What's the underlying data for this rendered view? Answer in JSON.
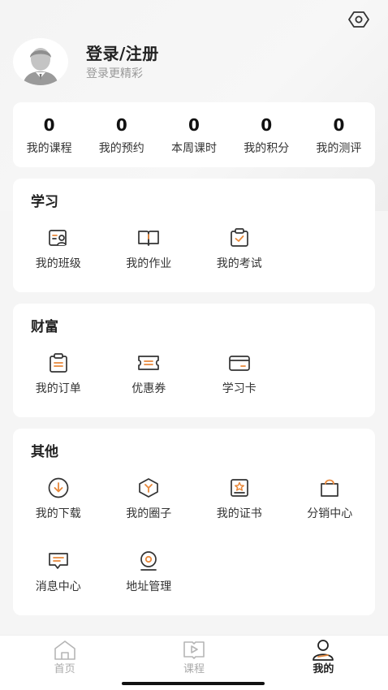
{
  "profile": {
    "title": "登录/注册",
    "subtitle": "登录更精彩"
  },
  "stats": [
    {
      "value": "0",
      "label": "我的课程"
    },
    {
      "value": "0",
      "label": "我的预约"
    },
    {
      "value": "0",
      "label": "本周课时"
    },
    {
      "value": "0",
      "label": "我的积分"
    },
    {
      "value": "0",
      "label": "我的测评"
    }
  ],
  "study": {
    "title": "学习",
    "items": [
      {
        "label": "我的班级",
        "icon": "class-icon"
      },
      {
        "label": "我的作业",
        "icon": "book-icon"
      },
      {
        "label": "我的考试",
        "icon": "clipboard-check-icon"
      }
    ]
  },
  "wealth": {
    "title": "财富",
    "items": [
      {
        "label": "我的订单",
        "icon": "order-icon"
      },
      {
        "label": "优惠券",
        "icon": "coupon-icon"
      },
      {
        "label": "学习卡",
        "icon": "card-icon"
      }
    ]
  },
  "other": {
    "title": "其他",
    "items": [
      {
        "label": "我的下载",
        "icon": "download-icon"
      },
      {
        "label": "我的圈子",
        "icon": "circle-icon"
      },
      {
        "label": "我的证书",
        "icon": "certificate-icon"
      },
      {
        "label": "分销中心",
        "icon": "bag-icon"
      },
      {
        "label": "消息中心",
        "icon": "message-icon"
      },
      {
        "label": "地址管理",
        "icon": "location-icon"
      }
    ]
  },
  "tabbar": [
    {
      "label": "首页",
      "icon": "home-icon",
      "active": false
    },
    {
      "label": "课程",
      "icon": "course-icon",
      "active": false
    },
    {
      "label": "我的",
      "icon": "user-icon",
      "active": true
    }
  ],
  "colors": {
    "accent": "#e8883a",
    "icon_stroke": "#333333",
    "inactive": "#aaaaaa"
  }
}
